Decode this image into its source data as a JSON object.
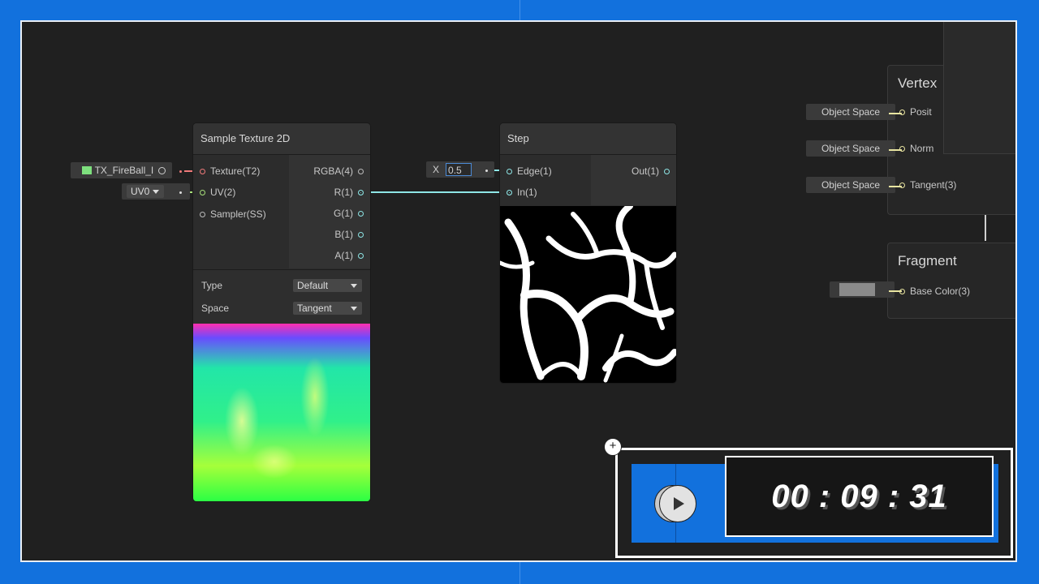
{
  "graph": {
    "sample_texture": {
      "title": "Sample Texture 2D",
      "inputs": [
        "Texture(T2)",
        "UV(2)",
        "Sampler(SS)"
      ],
      "outputs": [
        "RGBA(4)",
        "R(1)",
        "G(1)",
        "B(1)",
        "A(1)"
      ],
      "type_label": "Type",
      "type_value": "Default",
      "space_label": "Space",
      "space_value": "Tangent",
      "texture_chip": "TX_FireBall_I",
      "uv_chip": "UV0"
    },
    "step": {
      "title": "Step",
      "inputs": [
        "Edge(1)",
        "In(1)"
      ],
      "output": "Out(1)",
      "x_label": "X",
      "x_value": "0.5"
    },
    "vertex": {
      "title": "Vertex",
      "ports": [
        "Posit",
        "Norm",
        "Tangent(3)"
      ],
      "space_chips": [
        "Object Space",
        "Object Space",
        "Object Space"
      ]
    },
    "fragment": {
      "title": "Fragment",
      "port": "Base Color(3)"
    }
  },
  "timer": {
    "display": "00 : 09 : 31",
    "add_symbol": "+"
  },
  "colors": {
    "accent_blue": "#1271dd",
    "wire_teal": "#8ee6e6",
    "wire_yellow": "#e8e4a0"
  },
  "icons": {
    "play": "play-icon",
    "add": "plus-icon",
    "texture": "texture-icon",
    "target": "target-icon"
  }
}
